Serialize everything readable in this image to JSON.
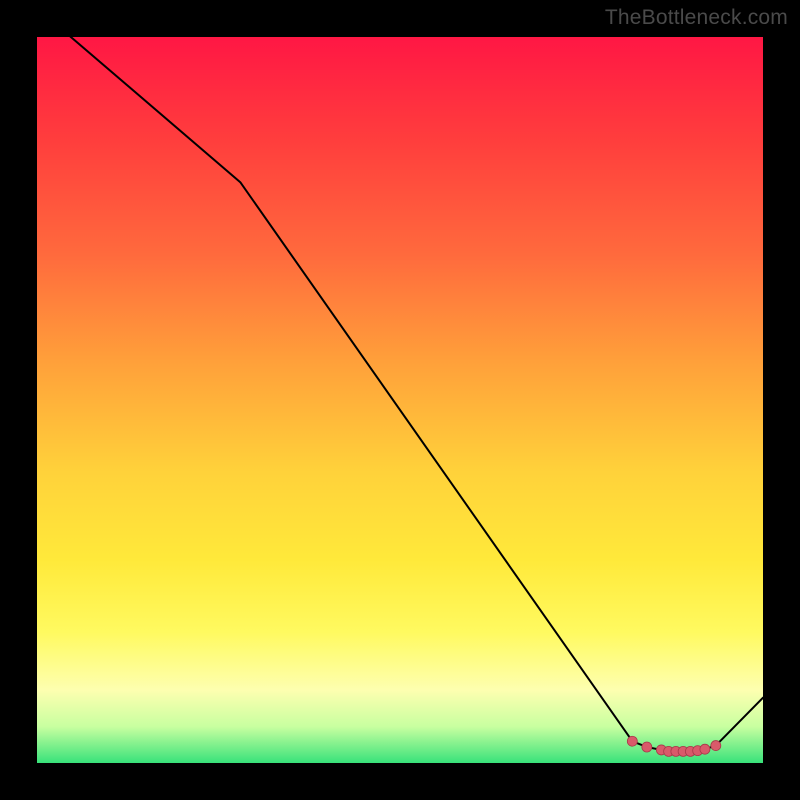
{
  "attribution": "TheBottleneck.com",
  "chart_data": {
    "type": "line",
    "title": "",
    "xlabel": "",
    "ylabel": "",
    "x": [
      0.0,
      0.28,
      0.82,
      0.84,
      0.86,
      0.87,
      0.88,
      0.89,
      0.9,
      0.91,
      0.92,
      0.935,
      1.0
    ],
    "y": [
      1.04,
      0.8,
      0.03,
      0.022,
      0.018,
      0.016,
      0.016,
      0.016,
      0.016,
      0.017,
      0.019,
      0.024,
      0.09
    ],
    "xlim": [
      0,
      1
    ],
    "ylim": [
      0,
      1
    ],
    "markers_x": [
      0.82,
      0.84,
      0.86,
      0.87,
      0.88,
      0.89,
      0.9,
      0.91,
      0.92,
      0.935
    ],
    "markers_y": [
      0.03,
      0.022,
      0.018,
      0.016,
      0.016,
      0.016,
      0.016,
      0.017,
      0.019,
      0.024
    ],
    "marker_color": "#d95a6a",
    "background_gradient": [
      "#ff1744",
      "#ffa13a",
      "#ffe93a",
      "#38e27a"
    ]
  }
}
